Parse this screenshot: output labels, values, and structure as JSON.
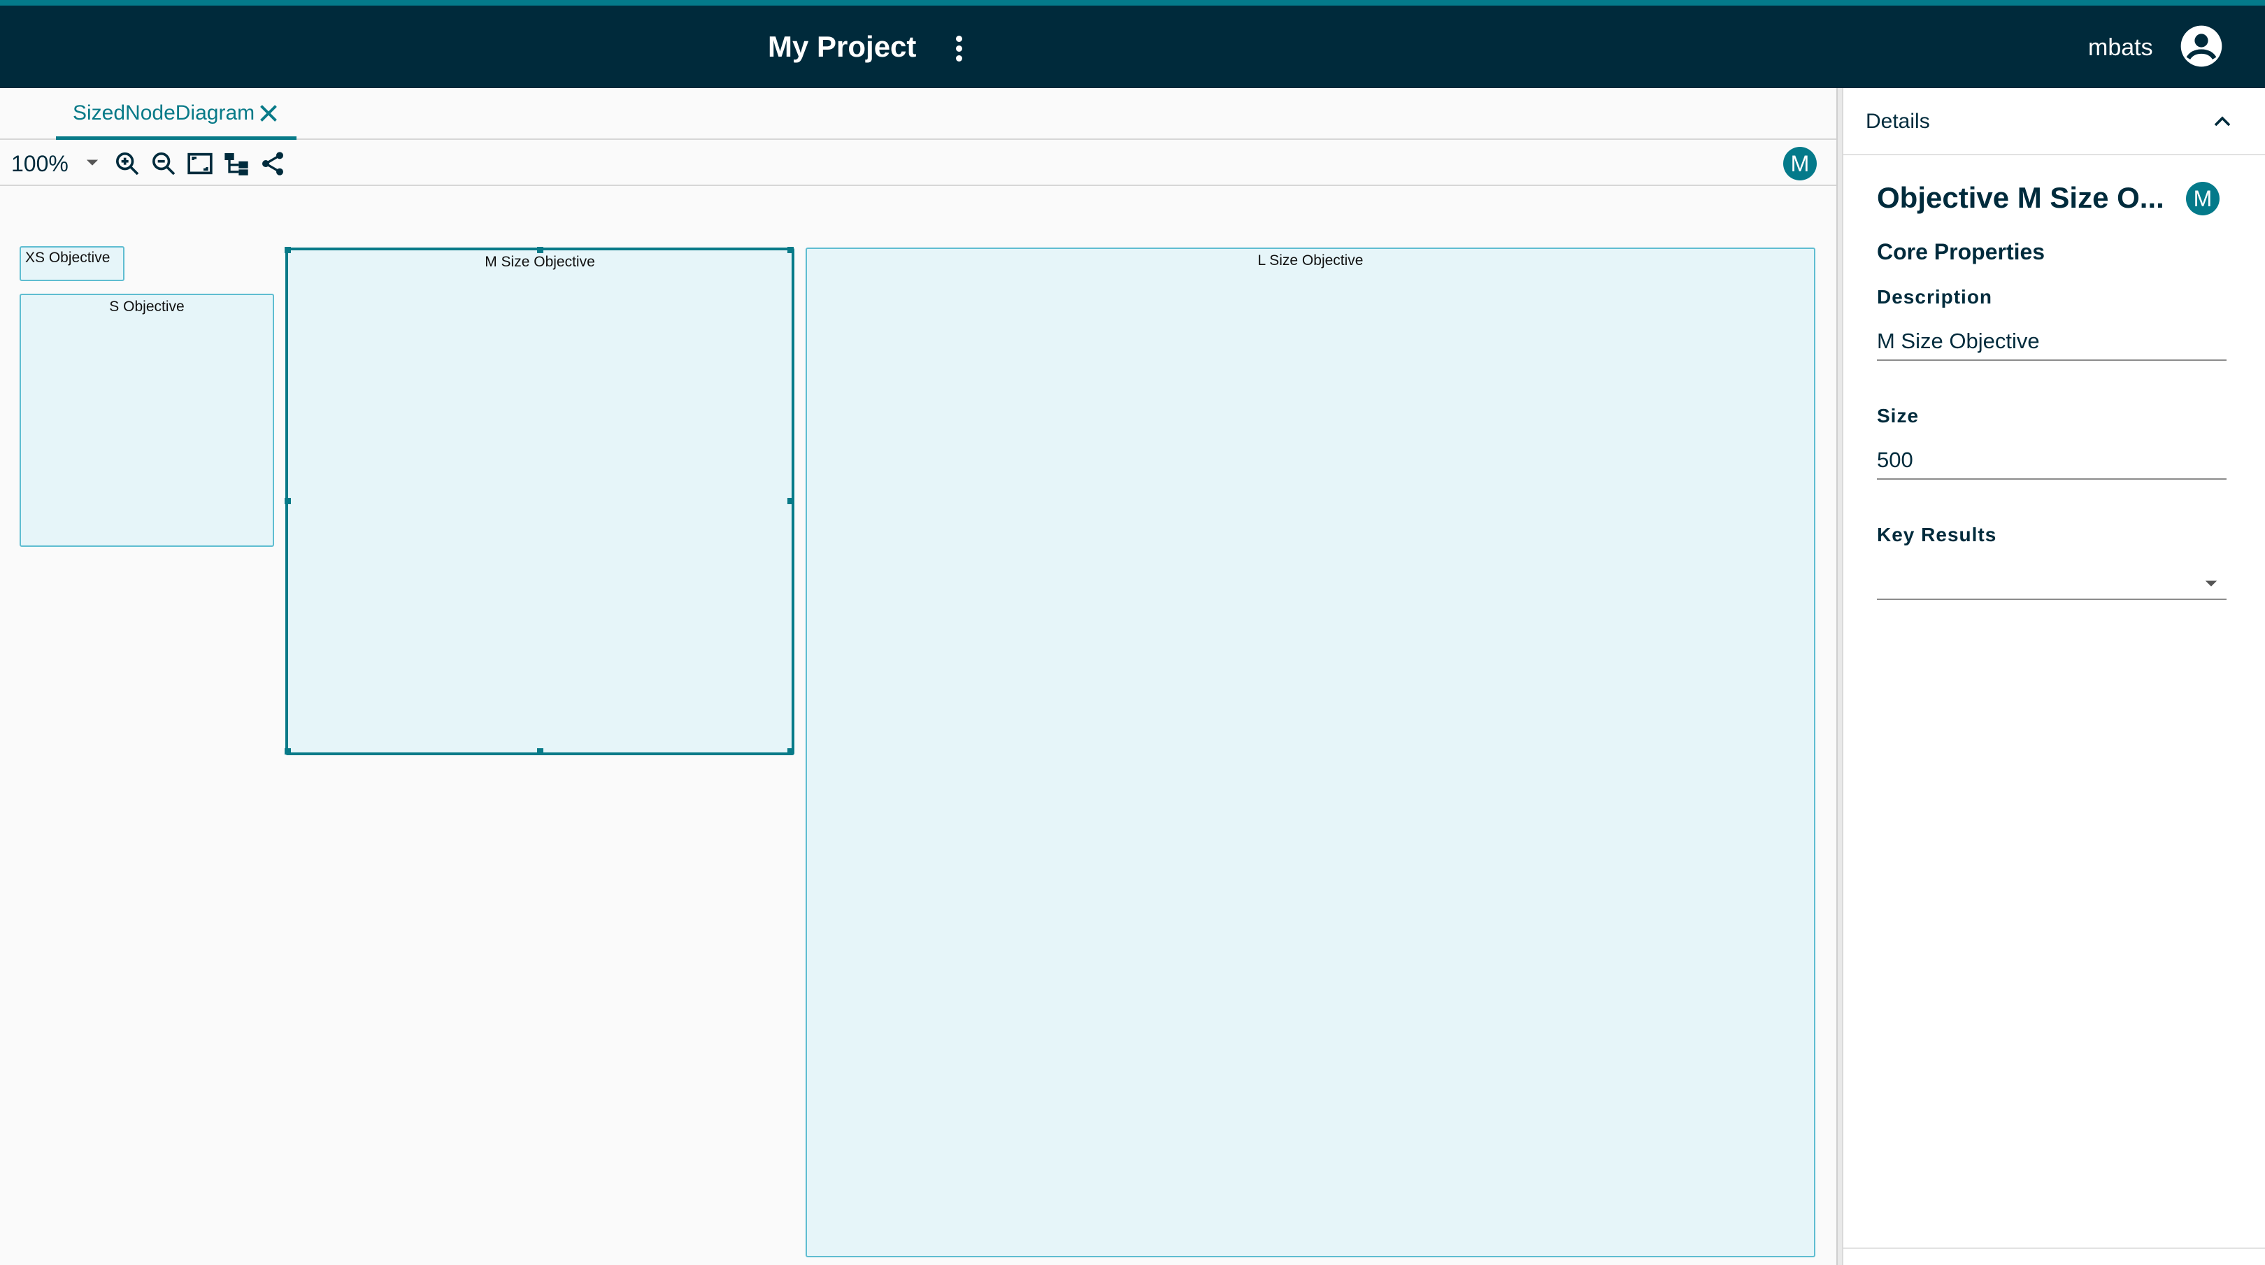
{
  "app": {
    "project_title": "My Project",
    "user_name": "mbats"
  },
  "tabs": [
    {
      "label": "SizedNodeDiagram",
      "active": true
    }
  ],
  "toolbar": {
    "zoom": "100%",
    "tools": [
      "zoom-in-icon",
      "zoom-out-icon",
      "fit-screen-icon",
      "layout-icon",
      "share-icon"
    ],
    "presence_badge": "M"
  },
  "diagram": {
    "nodes": [
      {
        "label": "XS Objective",
        "size": "XS"
      },
      {
        "label": "S Objective",
        "size": "S"
      },
      {
        "label": "M Size Objective",
        "size": "M",
        "selected": true
      },
      {
        "label": "L Size Objective",
        "size": "L"
      }
    ]
  },
  "details": {
    "header": "Details",
    "title": "Objective M Size O...",
    "badge": "M",
    "section": "Core Properties",
    "description_label": "Description",
    "description_value": "M Size Objective",
    "size_label": "Size",
    "size_value": "500",
    "key_results_label": "Key Results",
    "key_results_value": ""
  },
  "colors": {
    "header_bg": "#002a3b",
    "accent": "#047a8a",
    "node_fill": "#e6f5f9",
    "node_border": "#5fbdd1"
  }
}
